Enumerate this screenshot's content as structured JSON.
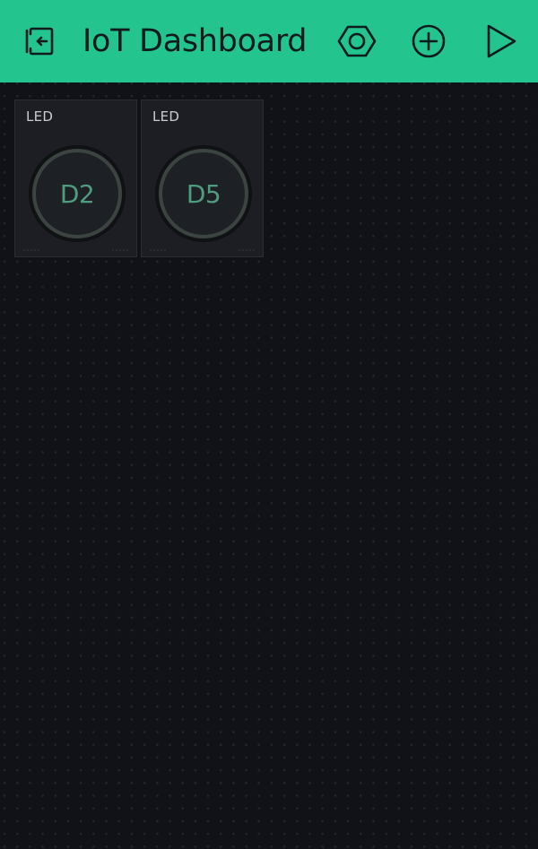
{
  "header": {
    "title": "IoT Dashboard",
    "background_color": "#23c48e",
    "icons": {
      "left": "exit-door-icon",
      "settings": "hexagon-settings-icon",
      "add": "plus-circle-icon",
      "play": "play-icon"
    }
  },
  "canvas": {
    "background_color": "#111217",
    "widgets": [
      {
        "type": "LED",
        "label": "LED",
        "pin": "D2"
      },
      {
        "type": "LED",
        "label": "LED",
        "pin": "D5"
      }
    ]
  },
  "colors": {
    "accent": "#23c48e",
    "led_off_ring": "#3c4441",
    "led_pin_text": "#4f9c80"
  }
}
